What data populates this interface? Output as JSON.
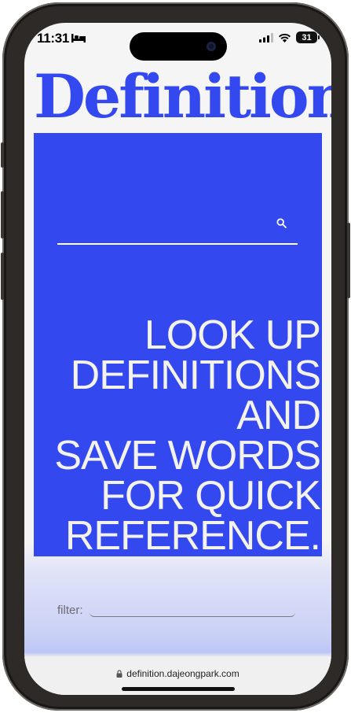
{
  "status_bar": {
    "time": "11:31",
    "sleep_icon": "bed-icon",
    "signal_icon": "cellular-signal-icon",
    "wifi_icon": "wifi-icon",
    "battery_level": "31"
  },
  "app": {
    "title": "Definition",
    "brand_color": "#3349ef"
  },
  "search": {
    "value": "",
    "icon": "search-icon"
  },
  "hero": {
    "tagline_lines": [
      "LOOK UP",
      "DEFINITIONS",
      "AND",
      "SAVE WORDS",
      "FOR QUICK",
      "REFERENCE."
    ]
  },
  "filter": {
    "label": "filter:",
    "value": ""
  },
  "browser": {
    "url": "definition.dajeongpark.com",
    "lock_icon": "lock-icon"
  }
}
